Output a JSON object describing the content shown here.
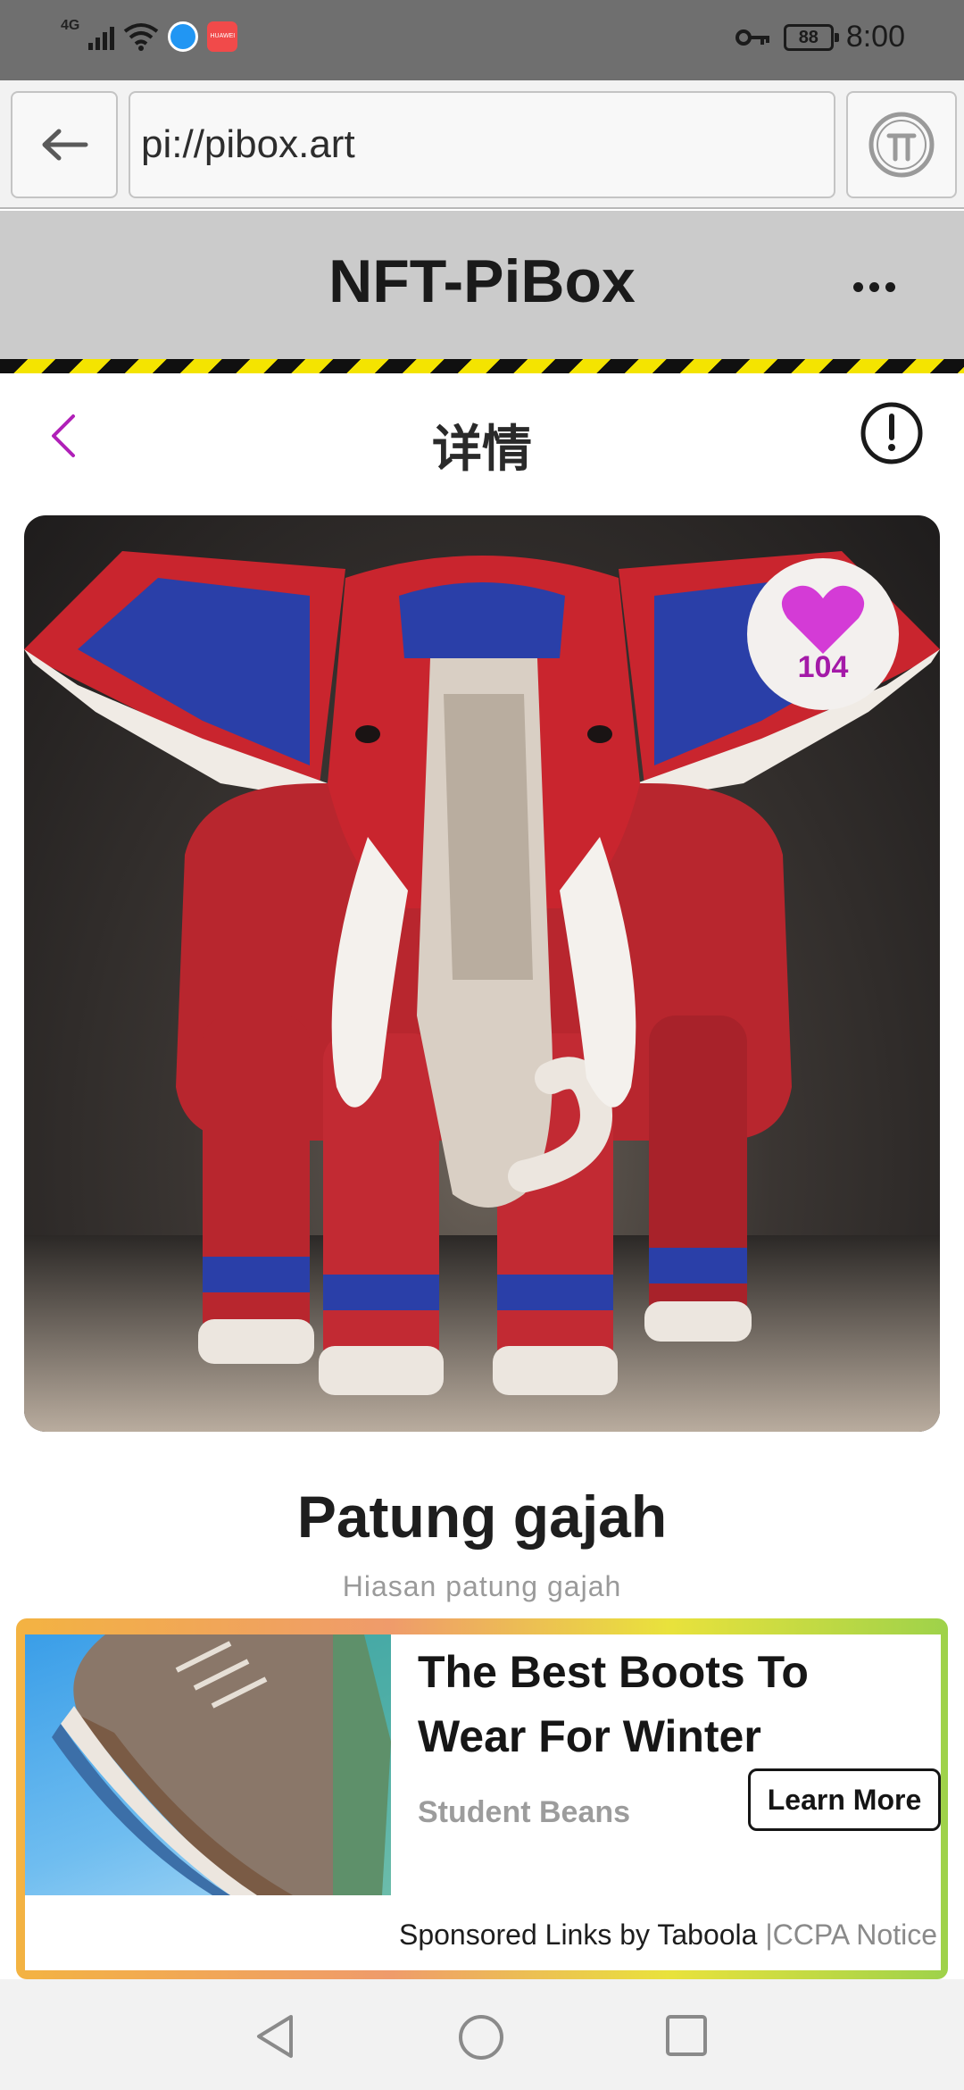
{
  "status_bar": {
    "network": "4G",
    "time": "8:00",
    "battery": "88",
    "app2_label": "HUAWEI"
  },
  "browser": {
    "url": "pi://pibox.art",
    "icons": {
      "back": "arrow-left-icon",
      "pi": "pi-logo-icon"
    }
  },
  "app_header": {
    "title": "NFT-PiBox",
    "more_icon": "more-horizontal-icon"
  },
  "detail": {
    "title": "详情",
    "back_icon": "chevron-left-icon",
    "info_icon": "info-circle-icon"
  },
  "artwork": {
    "likes": "104",
    "like_icon": "heart-icon",
    "accent": "#d43bd6"
  },
  "nft": {
    "name": "Patung gajah",
    "description": "Hiasan patung gajah"
  },
  "ad": {
    "headline": "The Best Boots To Wear For Winter",
    "source": "Student Beans",
    "cta": "Learn More",
    "footer_main": "Sponsored Links by Taboola",
    "footer_sep": "|",
    "footer_link": "CCPA Notice"
  },
  "system_nav": {
    "back_icon": "triangle-back-icon",
    "home_icon": "circle-home-icon",
    "recents_icon": "square-recents-icon"
  }
}
